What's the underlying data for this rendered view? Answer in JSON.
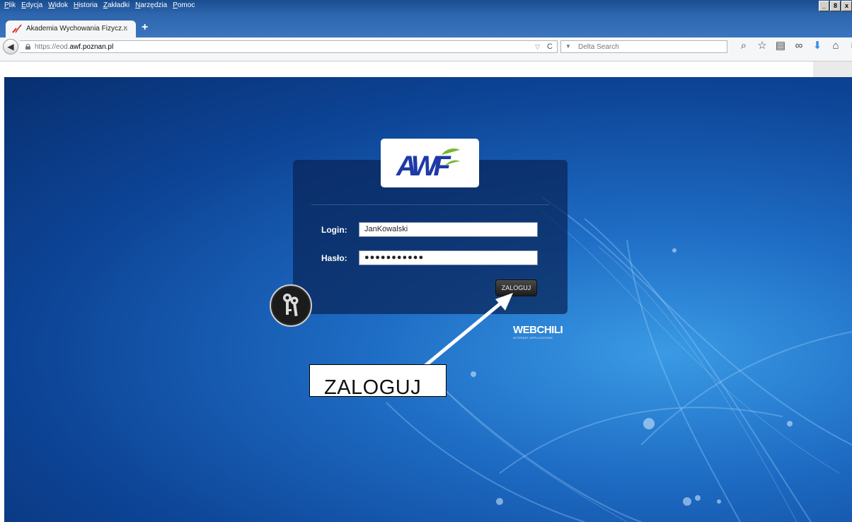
{
  "browser": {
    "menu": [
      "Plik",
      "Edycja",
      "Widok",
      "Historia",
      "Zakładki",
      "Narzędzia",
      "Pomoc"
    ],
    "window_controls": [
      "_",
      "8",
      "x"
    ],
    "tab": {
      "title": "Akademia Wychowania Fizycz...",
      "close": "×"
    },
    "new_tab": "+",
    "back": "◀",
    "url_prefix": "https://eod.",
    "url_domain": "awf.poznan.pl",
    "url_dropdown": "▽",
    "reload": "C",
    "search_placeholder": "Delta Search",
    "search_engine_icon": "▼",
    "toolbar_icons": [
      "search-go-icon",
      "star-icon",
      "reading-list-icon",
      "mask-icon",
      "download-icon",
      "home-icon",
      "menu-icon"
    ]
  },
  "login": {
    "logo_text": "AWF",
    "login_label": "Login:",
    "login_value": "JanKowalski",
    "password_label": "Hasło:",
    "password_value": "●●●●●●●●●●●",
    "submit_label": "ZALOGUJ",
    "vendor_logo": "WEBCHILI",
    "vendor_tagline": "INTERNET APPLICATIONS"
  },
  "annotation": {
    "callout_text": "ZALOGUJ"
  },
  "colors": {
    "background_blue": "#1e6cc4",
    "panel": "#082458",
    "button": "#2a2a2a",
    "logo_blue": "#1f3aa6",
    "logo_green": "#7ab532"
  }
}
